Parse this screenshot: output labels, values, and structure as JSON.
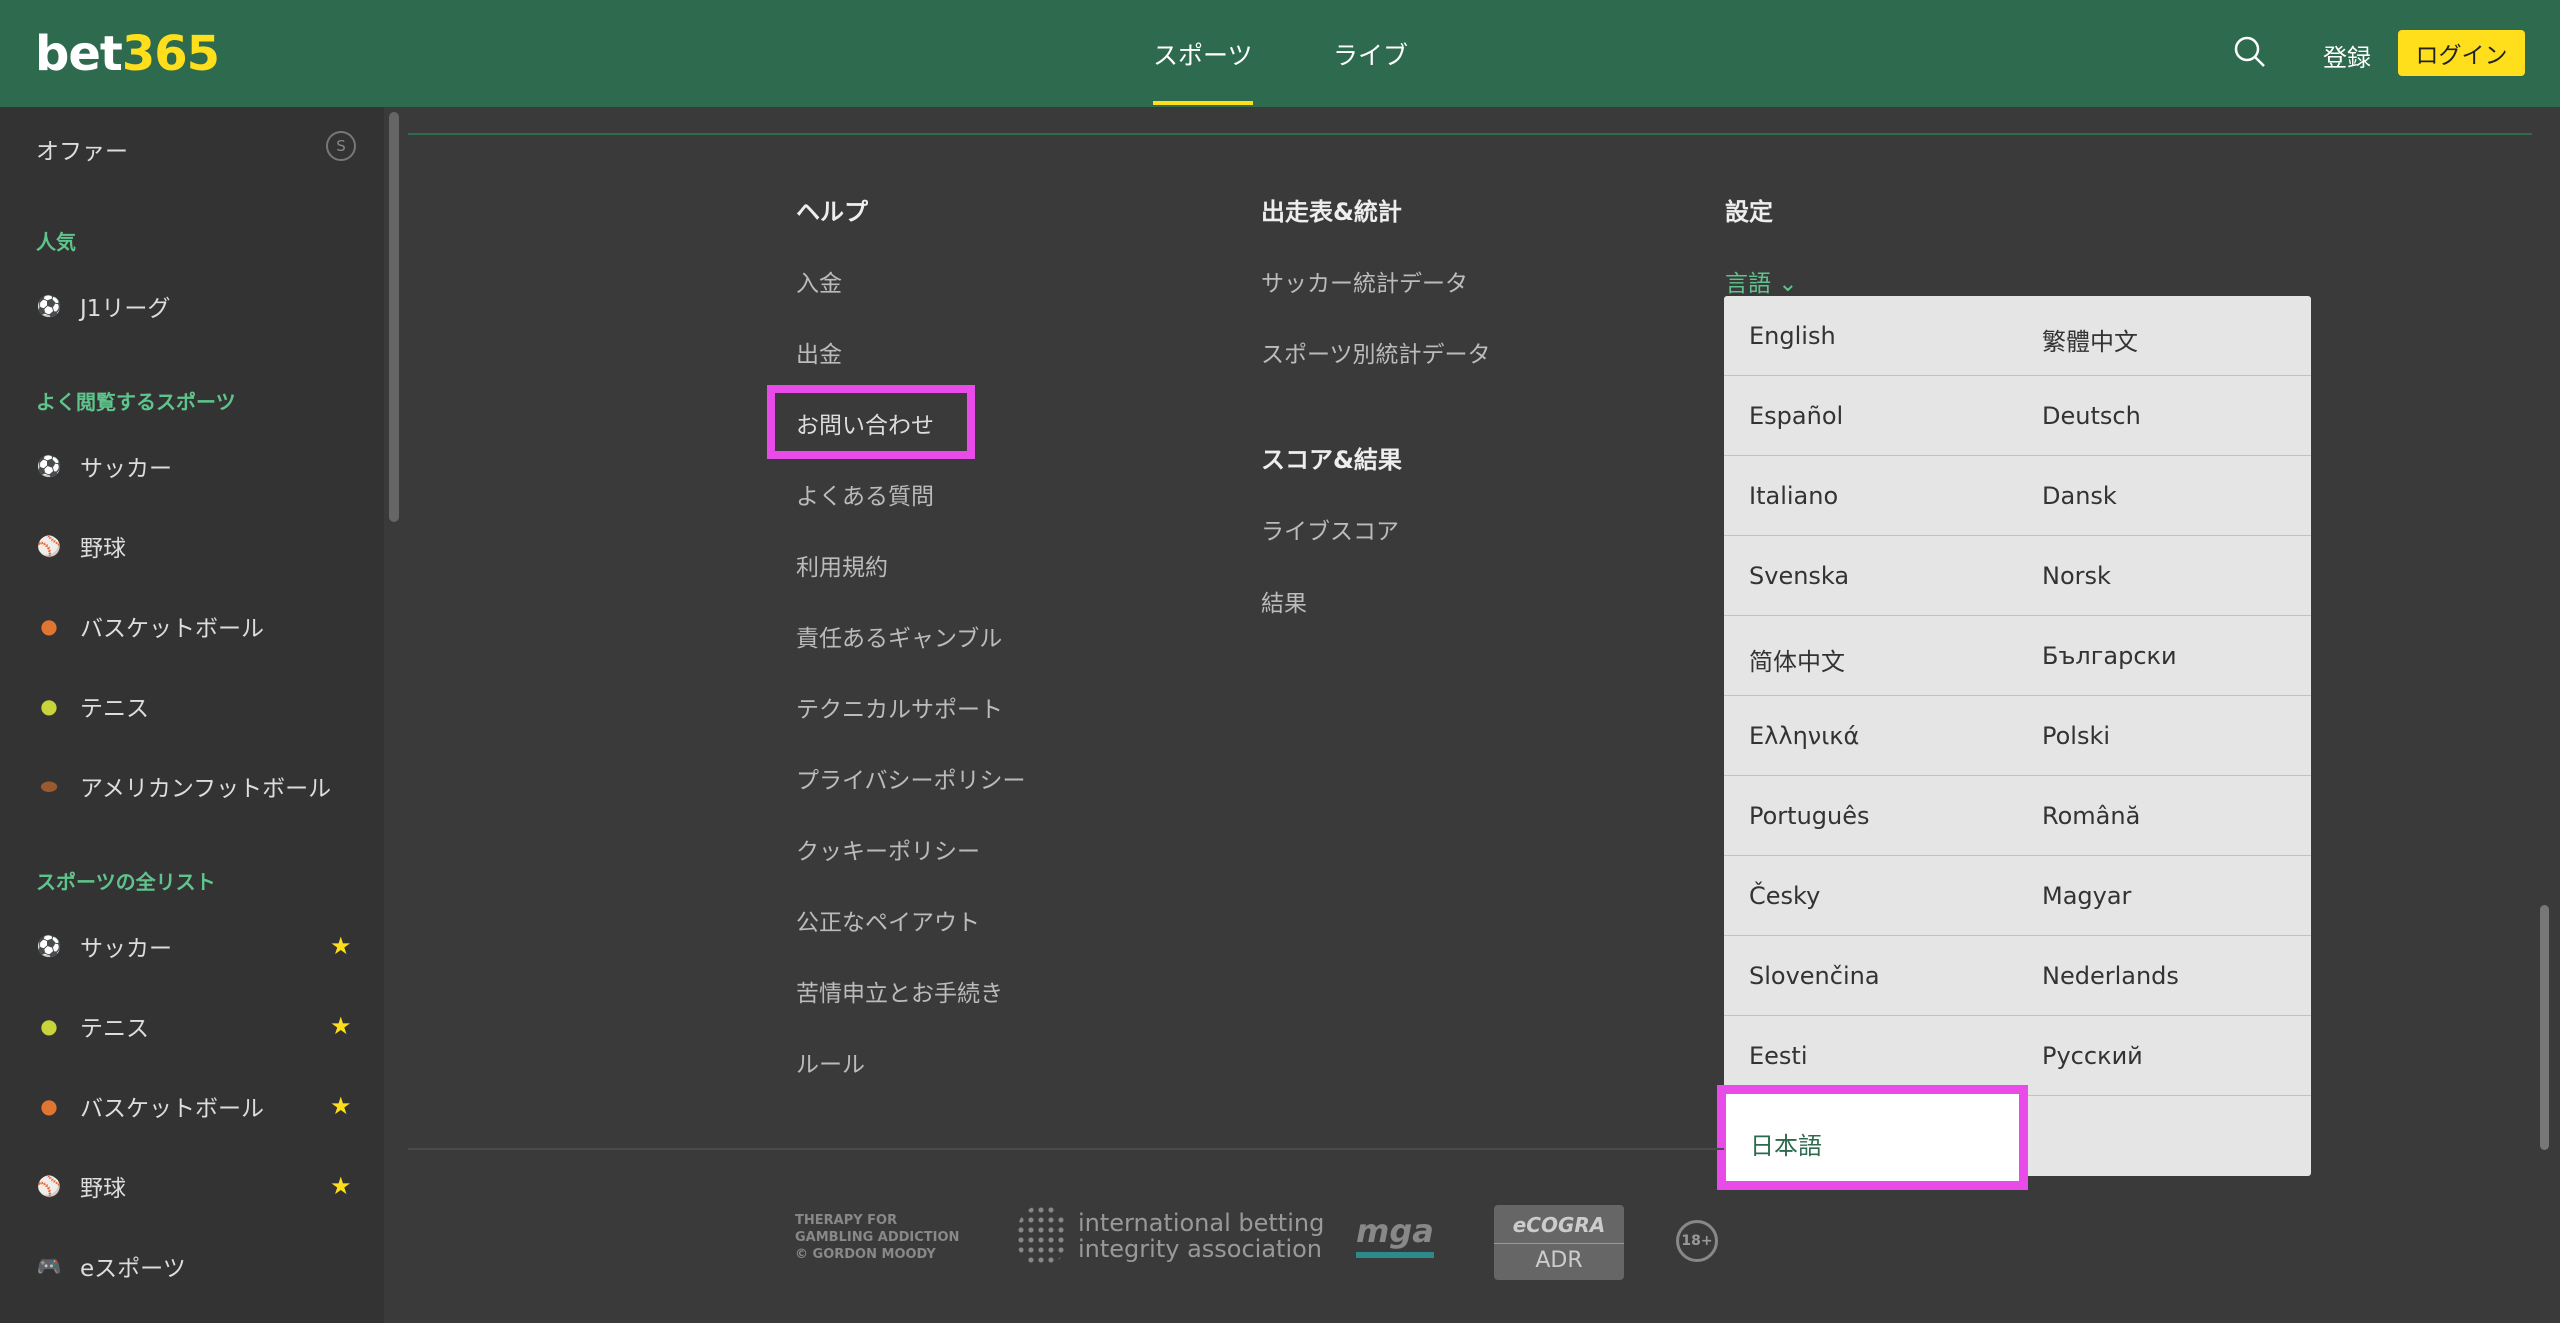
{
  "header": {
    "logo_bet": "bet",
    "logo_num": "365",
    "tabs": [
      "スポーツ",
      "ライブ"
    ],
    "register": "登録",
    "login": "ログイン"
  },
  "sidebar": {
    "offer": "オファー",
    "offer_icon": "S",
    "popular_heading": "人気",
    "popular": [
      "J1リーグ"
    ],
    "frequent_heading": "よく閲覧するスポーツ",
    "frequent": [
      "サッカー",
      "野球",
      "バスケットボール",
      "テニス",
      "アメリカンフットボール"
    ],
    "all_heading": "スポーツの全リスト",
    "all": [
      "サッカー",
      "テニス",
      "バスケットボール",
      "野球",
      "eスポーツ"
    ]
  },
  "footer": {
    "help_title": "ヘルプ",
    "help_links": [
      "入金",
      "出金",
      "お問い合わせ",
      "よくある質問",
      "利用規約",
      "責任あるギャンブル",
      "テクニカルサポート",
      "プライバシーポリシー",
      "クッキーポリシー",
      "公正なペイアウト",
      "苦情申立とお手続き",
      "ルール"
    ],
    "stats_title": "出走表&統計",
    "stats_links": [
      "サッカー統計データ",
      "スポーツ別統計データ"
    ],
    "scores_title": "スコア&結果",
    "scores_links": [
      "ライブスコア",
      "結果"
    ],
    "settings_title": "設定",
    "language_toggle": "言語 ⌄",
    "languages": [
      [
        "English",
        "繁體中文"
      ],
      [
        "Español",
        "Deutsch"
      ],
      [
        "Italiano",
        "Dansk"
      ],
      [
        "Svenska",
        "Norsk"
      ],
      [
        "简体中文",
        "Български"
      ],
      [
        "Ελληνικά",
        "Polski"
      ],
      [
        "Português",
        "Română"
      ],
      [
        "Česky",
        "Magyar"
      ],
      [
        "Slovenčina",
        "Nederlands"
      ],
      [
        "Eesti",
        "Русский"
      ]
    ],
    "selected_language": "日本語",
    "logos": {
      "gordon": "THERAPY FOR GAMBLING ADDICTION © GORDON MOODY",
      "ibia_1": "international betting",
      "ibia_2": "integrity association",
      "mga": "mga",
      "ecogra": "eCOGRA",
      "ecogra_sub": "ADR",
      "age": "18+"
    }
  },
  "colors": {
    "brand_green": "#2e6b4e",
    "brand_yellow": "#ffdf1b",
    "highlight": "#e84be8",
    "accent_text": "#5fc48c"
  }
}
